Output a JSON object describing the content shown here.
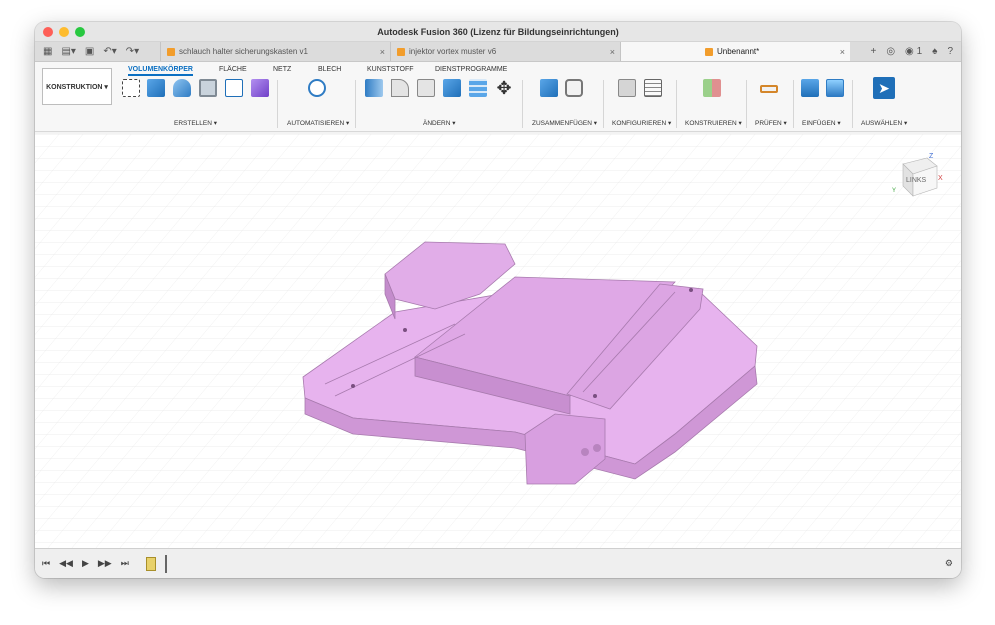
{
  "window": {
    "title": "Autodesk Fusion 360 (Lizenz für Bildungseinrichtungen)"
  },
  "tabs": [
    {
      "label": "schlauch halter sicherungskasten v1",
      "close": "×"
    },
    {
      "label": "injektor vortex muster v6",
      "close": "×"
    },
    {
      "label": "Unbenannt*",
      "close": "×"
    }
  ],
  "top_right": {
    "jobs_count": "1"
  },
  "workspace": {
    "label": "KONSTRUKTION ▾"
  },
  "ribbon_tabs": [
    "VOLUMENKÖRPER",
    "FLÄCHE",
    "NETZ",
    "BLECH",
    "KUNSTSTOFF",
    "DIENSTPROGRAMME"
  ],
  "groups": {
    "erstellen": "ERSTELLEN ▾",
    "automatisieren": "AUTOMATISIEREN ▾",
    "aendern": "ÄNDERN ▾",
    "zusammenfuegen": "ZUSAMMENFÜGEN ▾",
    "konfigurieren": "KONFIGURIEREN ▾",
    "konstruieren": "KONSTRUIEREN ▾",
    "pruefen": "PRÜFEN ▾",
    "einfuegen": "EINFÜGEN ▾",
    "auswaehlen": "AUSWÄHLEN ▾"
  },
  "viewcube": {
    "face": "LINKS",
    "axis_z": "Z",
    "axis_x": "X",
    "axis_y": "Y"
  },
  "colors": {
    "model": "#e7b3ee",
    "accent": "#0a6fc2"
  }
}
